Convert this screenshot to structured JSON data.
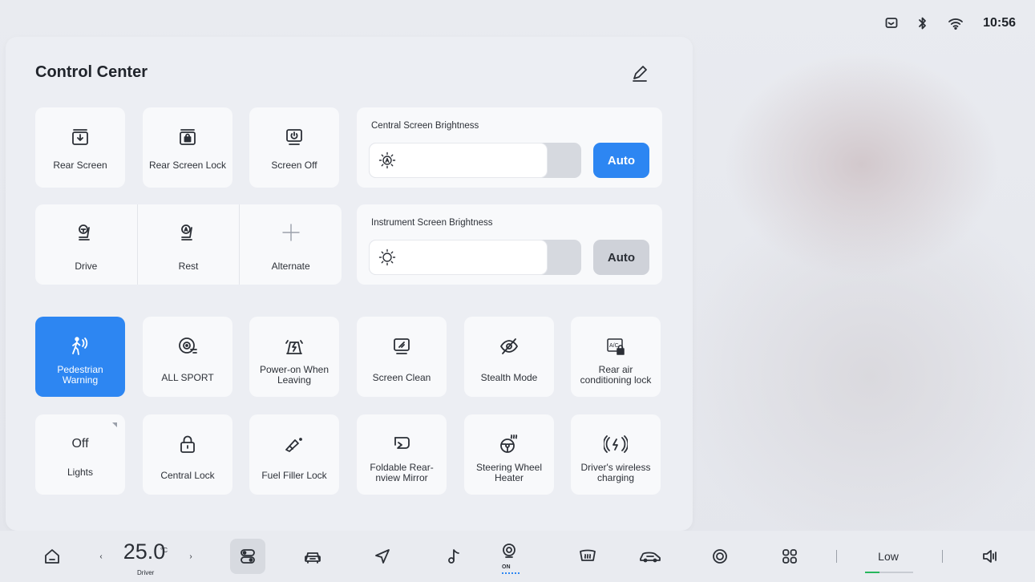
{
  "status": {
    "time": "10:56",
    "icons": [
      "message-icon",
      "bluetooth-icon",
      "wifi-icon"
    ]
  },
  "panel": {
    "title": "Control Center",
    "edit_icon": "pencil-icon",
    "top_tiles": [
      {
        "label": "Rear Screen",
        "icon": "rear-screen-icon"
      },
      {
        "label": "Rear Screen Lock",
        "icon": "rear-screen-lock-icon"
      },
      {
        "label": "Screen Off",
        "icon": "screen-off-icon"
      }
    ],
    "modes": [
      {
        "label": "Drive",
        "icon": "seat-drive-icon"
      },
      {
        "label": "Rest",
        "icon": "seat-rest-icon"
      },
      {
        "label": "Alternate",
        "icon": "plus-icon"
      }
    ],
    "central_brightness": {
      "label": "Central Screen Brightness",
      "auto_label": "Auto",
      "auto_on": true,
      "level": 0.84
    },
    "instrument_brightness": {
      "label": "Instrument Screen Brightness",
      "auto_label": "Auto",
      "auto_on": false,
      "level": 0.84
    },
    "row1": [
      {
        "label": "Pedestrian Warning",
        "icon": "pedestrian-icon",
        "active": true
      },
      {
        "label": "ALL SPORT",
        "icon": "sport-wheel-icon",
        "active": false
      },
      {
        "label": "Power-on When Leaving",
        "icon": "power-on-leaving-icon",
        "active": false
      },
      {
        "label": "Screen Clean",
        "icon": "screen-clean-icon",
        "active": false
      },
      {
        "label": "Stealth Mode",
        "icon": "stealth-icon",
        "active": false
      },
      {
        "label": "Rear air conditioning lock",
        "icon": "ac-lock-icon",
        "active": false
      }
    ],
    "row2": [
      {
        "label": "Lights",
        "value": "Off",
        "icon": "lights-icon"
      },
      {
        "label": "Central Lock",
        "icon": "lock-icon"
      },
      {
        "label": "Fuel Filler Lock",
        "icon": "fuel-filler-icon"
      },
      {
        "label": "Foldable Rear-nview Mirror",
        "icon": "mirror-icon"
      },
      {
        "label": "Steering Wheel Heater",
        "icon": "steering-heat-icon"
      },
      {
        "label": "Driver's wireless charging",
        "icon": "wireless-charging-icon"
      }
    ]
  },
  "dock": {
    "temperature": "25.0",
    "temperature_unit": "°C",
    "temperature_zone": "Driver",
    "fan_label": "Low",
    "fan_level": 0.3,
    "seat_heat_label": "ON",
    "items": [
      "home-icon",
      "control-center-icon",
      "car-icon",
      "navigation-icon",
      "music-icon",
      "seat-heat-icon",
      "defrost-icon",
      "car-side-icon",
      "camera-icon",
      "apps-icon",
      "volume-icon"
    ]
  }
}
